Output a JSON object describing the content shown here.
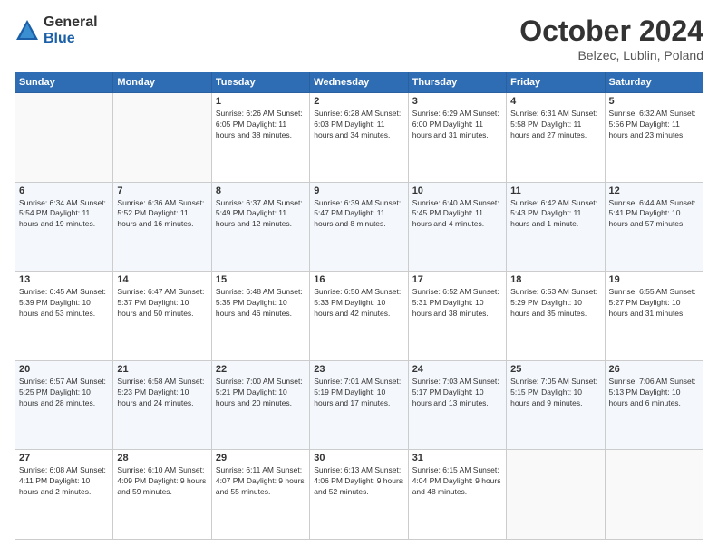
{
  "header": {
    "logo_general": "General",
    "logo_blue": "Blue",
    "month_title": "October 2024",
    "location": "Belzec, Lublin, Poland"
  },
  "weekdays": [
    "Sunday",
    "Monday",
    "Tuesday",
    "Wednesday",
    "Thursday",
    "Friday",
    "Saturday"
  ],
  "weeks": [
    [
      {
        "day": "",
        "info": ""
      },
      {
        "day": "",
        "info": ""
      },
      {
        "day": "1",
        "info": "Sunrise: 6:26 AM\nSunset: 6:05 PM\nDaylight: 11 hours and 38 minutes."
      },
      {
        "day": "2",
        "info": "Sunrise: 6:28 AM\nSunset: 6:03 PM\nDaylight: 11 hours and 34 minutes."
      },
      {
        "day": "3",
        "info": "Sunrise: 6:29 AM\nSunset: 6:00 PM\nDaylight: 11 hours and 31 minutes."
      },
      {
        "day": "4",
        "info": "Sunrise: 6:31 AM\nSunset: 5:58 PM\nDaylight: 11 hours and 27 minutes."
      },
      {
        "day": "5",
        "info": "Sunrise: 6:32 AM\nSunset: 5:56 PM\nDaylight: 11 hours and 23 minutes."
      }
    ],
    [
      {
        "day": "6",
        "info": "Sunrise: 6:34 AM\nSunset: 5:54 PM\nDaylight: 11 hours and 19 minutes."
      },
      {
        "day": "7",
        "info": "Sunrise: 6:36 AM\nSunset: 5:52 PM\nDaylight: 11 hours and 16 minutes."
      },
      {
        "day": "8",
        "info": "Sunrise: 6:37 AM\nSunset: 5:49 PM\nDaylight: 11 hours and 12 minutes."
      },
      {
        "day": "9",
        "info": "Sunrise: 6:39 AM\nSunset: 5:47 PM\nDaylight: 11 hours and 8 minutes."
      },
      {
        "day": "10",
        "info": "Sunrise: 6:40 AM\nSunset: 5:45 PM\nDaylight: 11 hours and 4 minutes."
      },
      {
        "day": "11",
        "info": "Sunrise: 6:42 AM\nSunset: 5:43 PM\nDaylight: 11 hours and 1 minute."
      },
      {
        "day": "12",
        "info": "Sunrise: 6:44 AM\nSunset: 5:41 PM\nDaylight: 10 hours and 57 minutes."
      }
    ],
    [
      {
        "day": "13",
        "info": "Sunrise: 6:45 AM\nSunset: 5:39 PM\nDaylight: 10 hours and 53 minutes."
      },
      {
        "day": "14",
        "info": "Sunrise: 6:47 AM\nSunset: 5:37 PM\nDaylight: 10 hours and 50 minutes."
      },
      {
        "day": "15",
        "info": "Sunrise: 6:48 AM\nSunset: 5:35 PM\nDaylight: 10 hours and 46 minutes."
      },
      {
        "day": "16",
        "info": "Sunrise: 6:50 AM\nSunset: 5:33 PM\nDaylight: 10 hours and 42 minutes."
      },
      {
        "day": "17",
        "info": "Sunrise: 6:52 AM\nSunset: 5:31 PM\nDaylight: 10 hours and 38 minutes."
      },
      {
        "day": "18",
        "info": "Sunrise: 6:53 AM\nSunset: 5:29 PM\nDaylight: 10 hours and 35 minutes."
      },
      {
        "day": "19",
        "info": "Sunrise: 6:55 AM\nSunset: 5:27 PM\nDaylight: 10 hours and 31 minutes."
      }
    ],
    [
      {
        "day": "20",
        "info": "Sunrise: 6:57 AM\nSunset: 5:25 PM\nDaylight: 10 hours and 28 minutes."
      },
      {
        "day": "21",
        "info": "Sunrise: 6:58 AM\nSunset: 5:23 PM\nDaylight: 10 hours and 24 minutes."
      },
      {
        "day": "22",
        "info": "Sunrise: 7:00 AM\nSunset: 5:21 PM\nDaylight: 10 hours and 20 minutes."
      },
      {
        "day": "23",
        "info": "Sunrise: 7:01 AM\nSunset: 5:19 PM\nDaylight: 10 hours and 17 minutes."
      },
      {
        "day": "24",
        "info": "Sunrise: 7:03 AM\nSunset: 5:17 PM\nDaylight: 10 hours and 13 minutes."
      },
      {
        "day": "25",
        "info": "Sunrise: 7:05 AM\nSunset: 5:15 PM\nDaylight: 10 hours and 9 minutes."
      },
      {
        "day": "26",
        "info": "Sunrise: 7:06 AM\nSunset: 5:13 PM\nDaylight: 10 hours and 6 minutes."
      }
    ],
    [
      {
        "day": "27",
        "info": "Sunrise: 6:08 AM\nSunset: 4:11 PM\nDaylight: 10 hours and 2 minutes."
      },
      {
        "day": "28",
        "info": "Sunrise: 6:10 AM\nSunset: 4:09 PM\nDaylight: 9 hours and 59 minutes."
      },
      {
        "day": "29",
        "info": "Sunrise: 6:11 AM\nSunset: 4:07 PM\nDaylight: 9 hours and 55 minutes."
      },
      {
        "day": "30",
        "info": "Sunrise: 6:13 AM\nSunset: 4:06 PM\nDaylight: 9 hours and 52 minutes."
      },
      {
        "day": "31",
        "info": "Sunrise: 6:15 AM\nSunset: 4:04 PM\nDaylight: 9 hours and 48 minutes."
      },
      {
        "day": "",
        "info": ""
      },
      {
        "day": "",
        "info": ""
      }
    ]
  ]
}
